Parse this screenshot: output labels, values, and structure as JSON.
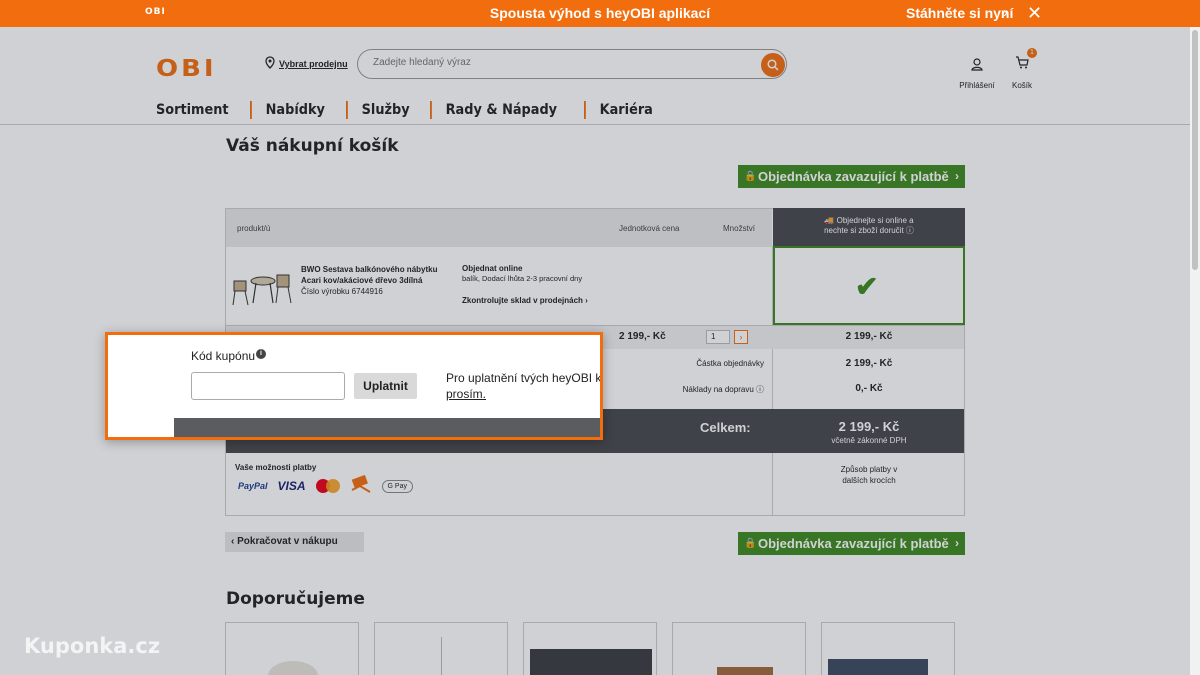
{
  "banner": {
    "logo": "OBI",
    "title": "Spousta výhod s heyOBI aplikací",
    "download": "Stáhněte si nyní"
  },
  "header": {
    "logo": "OBI",
    "store_link": "Vybrat prodejnu",
    "search_placeholder": "Zadejte hledaný výraz",
    "login_label": "Přihlášení",
    "cart_label": "Košík",
    "cart_count": "1"
  },
  "nav": [
    "Sortiment",
    "Nabídky",
    "Služby",
    "Rady & Nápady",
    "Kariéra"
  ],
  "cart": {
    "title": "Váš nákupní košík",
    "order_button": "Objednávka zavazující k platbě",
    "columns": {
      "product": "produkt/ú",
      "unit_price": "Jednotková cena",
      "quantity": "Množství",
      "delivery_line1": "Objednejte si online a",
      "delivery_line2": "nechte si zboží doručit"
    },
    "item": {
      "name": "BWO Sestava balkónového nábytku Acari kov/akáciové dřevo 3dílná",
      "number": "Číslo výrobku 6744916",
      "ship_title": "Objednat online",
      "ship_sub": "balík, Dodací lhůta 2-3 pracovní dny",
      "stock_link": "Zkontrolujte sklad v prodejnách",
      "unit_price": "2 199,- Kč",
      "quantity": "1",
      "row_total": "2 199,- Kč"
    },
    "summary": {
      "order_amount_label": "Částka objednávky",
      "order_amount": "2 199,- Kč",
      "shipping_label": "Náklady na dopravu",
      "shipping": "0,- Kč",
      "total_label": "Celkem:",
      "total": "2 199,- Kč",
      "vat_note": "včetně zákonné DPH"
    },
    "payment": {
      "label": "Vaše možnosti platby",
      "paypal": "PayPal",
      "visa": "VISA",
      "gpay": "G Pay",
      "note_line1": "Způsob platby v",
      "note_line2": "dalších krocích"
    },
    "continue_button": "Pokračovat v nákupu"
  },
  "recommend": {
    "title": "Doporučujeme"
  },
  "coupon": {
    "label": "Kód kupónu",
    "apply": "Uplatnit",
    "note_line1": "Pro uplatnění tvých heyOBI ku",
    "note_link": "prosím."
  },
  "watermark": "Kuponka.cz",
  "colors": {
    "brand": "#f26d0d",
    "green": "#3d8a1e",
    "dark": "#46484c"
  }
}
